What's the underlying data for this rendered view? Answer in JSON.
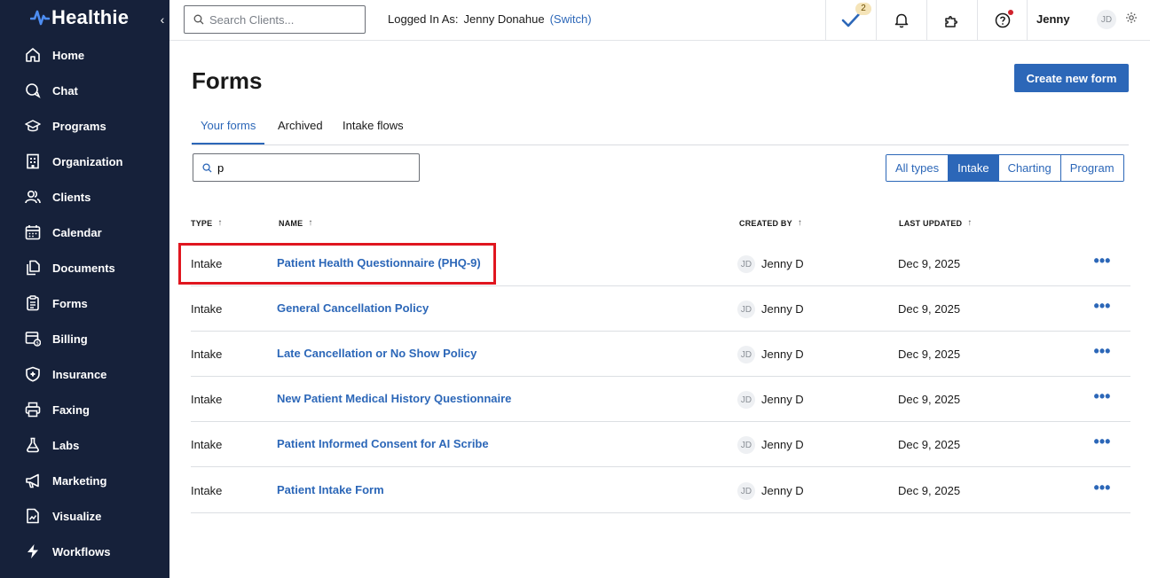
{
  "app": {
    "name": "Healthie",
    "brand_color": "#16213a",
    "accent_color": "#2c67b8"
  },
  "sidebar": {
    "collapse_icon": "chevron-left-icon",
    "items": [
      {
        "label": "Home",
        "icon": "home-icon"
      },
      {
        "label": "Chat",
        "icon": "chat-icon"
      },
      {
        "label": "Programs",
        "icon": "programs-icon"
      },
      {
        "label": "Organization",
        "icon": "building-icon"
      },
      {
        "label": "Clients",
        "icon": "users-icon"
      },
      {
        "label": "Calendar",
        "icon": "calendar-icon"
      },
      {
        "label": "Documents",
        "icon": "documents-icon"
      },
      {
        "label": "Forms",
        "icon": "clipboard-icon"
      },
      {
        "label": "Billing",
        "icon": "billing-icon"
      },
      {
        "label": "Insurance",
        "icon": "shield-icon"
      },
      {
        "label": "Faxing",
        "icon": "printer-icon"
      },
      {
        "label": "Labs",
        "icon": "flask-icon"
      },
      {
        "label": "Marketing",
        "icon": "megaphone-icon"
      },
      {
        "label": "Visualize",
        "icon": "chart-file-icon"
      },
      {
        "label": "Workflows",
        "icon": "lightning-icon"
      }
    ]
  },
  "topbar": {
    "search_placeholder": "Search Clients...",
    "logged_in_label": "Logged In As:",
    "logged_in_user": "Jenny Donahue",
    "switch_label": "(Switch)",
    "tasks_count": "2",
    "user_name": "Jenny",
    "user_initials": "JD"
  },
  "page": {
    "title": "Forms",
    "create_button": "Create new form",
    "tabs": [
      {
        "label": "Your forms",
        "active": true
      },
      {
        "label": "Archived",
        "active": false
      },
      {
        "label": "Intake flows",
        "active": false
      }
    ],
    "filter_value": "p",
    "type_filters": [
      {
        "label": "All types",
        "active": false
      },
      {
        "label": "Intake",
        "active": true
      },
      {
        "label": "Charting",
        "active": false
      },
      {
        "label": "Program",
        "active": false
      }
    ]
  },
  "table": {
    "headers": {
      "type": "TYPE",
      "name": "NAME",
      "created_by": "CREATED BY",
      "last_updated": "LAST UPDATED"
    },
    "rows": [
      {
        "type": "Intake",
        "name": "Patient Health Questionnaire (PHQ-9)",
        "initials": "JD",
        "creator": "Jenny D",
        "updated": "Dec 9, 2025"
      },
      {
        "type": "Intake",
        "name": "General Cancellation Policy",
        "initials": "JD",
        "creator": "Jenny D",
        "updated": "Dec 9, 2025"
      },
      {
        "type": "Intake",
        "name": "Late Cancellation or No Show Policy",
        "initials": "JD",
        "creator": "Jenny D",
        "updated": "Dec 9, 2025"
      },
      {
        "type": "Intake",
        "name": "New Patient Medical History Questionnaire",
        "initials": "JD",
        "creator": "Jenny D",
        "updated": "Dec 9, 2025"
      },
      {
        "type": "Intake",
        "name": "Patient Informed Consent for AI Scribe",
        "initials": "JD",
        "creator": "Jenny D",
        "updated": "Dec 9, 2025"
      },
      {
        "type": "Intake",
        "name": "Patient Intake Form",
        "initials": "JD",
        "creator": "Jenny D",
        "updated": "Dec 9, 2025"
      }
    ]
  }
}
